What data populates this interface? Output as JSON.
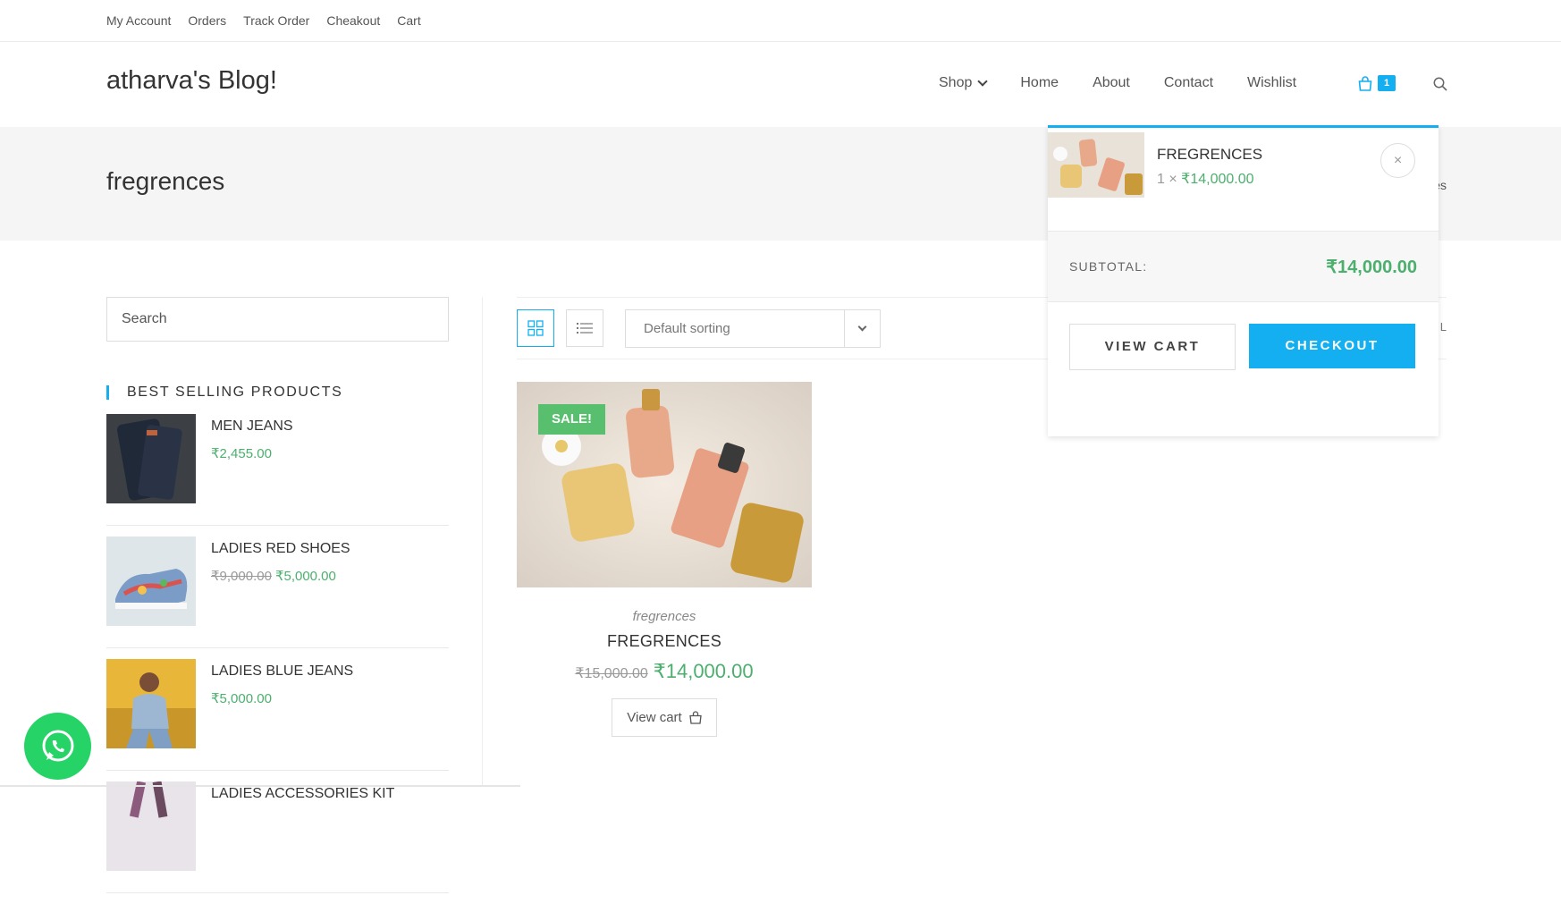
{
  "topbar": {
    "links": [
      "My Account",
      "Orders",
      "Track Order",
      "Cheakout",
      "Cart"
    ]
  },
  "header": {
    "site_title": "atharva's Blog!",
    "nav": [
      "Shop",
      "Home",
      "About",
      "Contact",
      "Wishlist"
    ],
    "cart_count": "1"
  },
  "page_header": {
    "title": "fregrences",
    "breadcrumb_fragment": "es"
  },
  "sidebar": {
    "search_placeholder": "Search",
    "widget_title": "BEST SELLING PRODUCTS",
    "products": [
      {
        "name": "MEN JEANS",
        "old_price": "",
        "price": "₹2,455.00",
        "thumb": "jeans-photo"
      },
      {
        "name": "LADIES RED SHOES",
        "old_price": "₹9,000.00",
        "price": "₹5,000.00",
        "thumb": "shoes-photo"
      },
      {
        "name": "LADIES BLUE JEANS",
        "old_price": "",
        "price": "₹5,000.00",
        "thumb": "woman-photo"
      },
      {
        "name": "LADIES ACCESSORIES KIT",
        "old_price": "",
        "price": "",
        "thumb": "accessories-photo"
      }
    ]
  },
  "toolbar": {
    "sort_value": "Default sorting",
    "right_fragment": "L"
  },
  "product": {
    "badge": "SALE!",
    "category": "fregrences",
    "name": "FREGRENCES",
    "old_price": "₹15,000.00",
    "price": "₹14,000.00",
    "button": "View cart"
  },
  "minicart": {
    "item_name": "FREGRENCES",
    "item_qty": "1 ×",
    "item_price": "₹14,000.00",
    "remove": "×",
    "subtotal_label": "SUBTOTAL:",
    "subtotal_value": "₹14,000.00",
    "view_cart": "VIEW CART",
    "checkout": "CHECKOUT"
  },
  "colors": {
    "accent": "#13aff0",
    "price_green": "#4caf6e",
    "sale_badge": "#57bf6d",
    "whatsapp": "#25d366"
  }
}
